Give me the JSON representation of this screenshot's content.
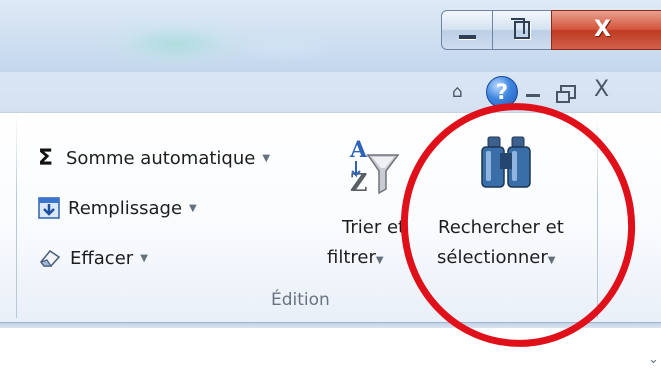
{
  "window": {
    "minimize_icon": "minimize-icon",
    "restore_icon": "restore-icon",
    "close_glyph": "X"
  },
  "helpbar": {
    "minimize_ribbon_glyph": "⌂",
    "help_glyph": "?",
    "doc_close_glyph": "X"
  },
  "edition_group": {
    "autosum_symbol": "Σ",
    "autosum_label": "Somme automatique",
    "fill_label": "Remplissage",
    "clear_label": "Effacer",
    "sort_filter_label_line1": "Trier et",
    "sort_filter_label_line2": "filtrer",
    "find_select_label_line1": "Rechercher et",
    "find_select_label_line2": "sélectionner",
    "group_label": "Édition",
    "dropdown_glyph": "▼"
  },
  "annotation": {
    "circle_color": "#e0101a"
  },
  "sheet": {
    "scroll_glyph": "⌄"
  }
}
